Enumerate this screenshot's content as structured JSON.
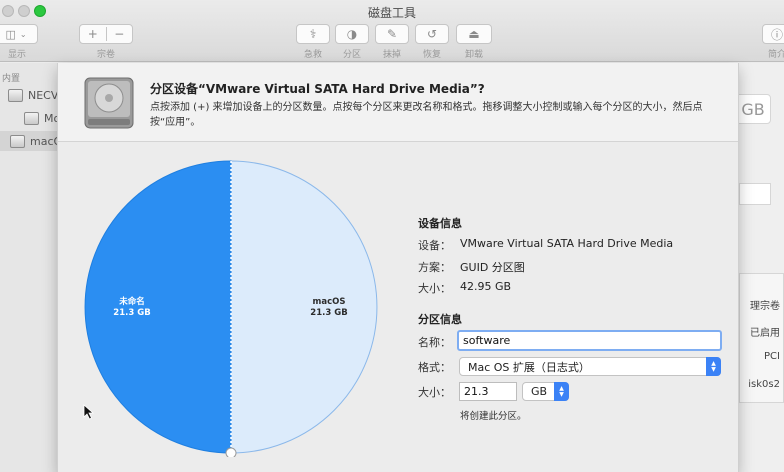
{
  "window": {
    "title": "磁盘工具",
    "toolbar": {
      "view_label": "显示",
      "volume_label": "宗卷",
      "first_aid_label": "急救",
      "partition_label": "分区",
      "erase_label": "抹掉",
      "restore_label": "恢复",
      "unmount_label": "卸载",
      "info_label": "简介"
    }
  },
  "sidebar": {
    "header": "内置",
    "items": [
      {
        "label": "NECV"
      },
      {
        "label": "Mo"
      },
      {
        "label": "macO"
      }
    ]
  },
  "background_right": {
    "capacity_unit": "GB",
    "row1": "理宗卷",
    "row2": "已启用",
    "row3": "PCI",
    "row4": "isk0s2"
  },
  "sheet": {
    "title": "分区设备“VMware Virtual SATA Hard Drive Media”?",
    "description": "点按添加 (+) 来增加设备上的分区数量。点按每个分区来更改名称和格式。拖移调整大小控制或输入每个分区的大小，然后点按“应用”。",
    "device_info": {
      "heading": "设备信息",
      "device_key": "设备：",
      "device_val": "VMware Virtual SATA Hard Drive Media",
      "scheme_key": "方案：",
      "scheme_val": "GUID 分区图",
      "size_key": "大小：",
      "size_val": "42.95 GB"
    },
    "partition_info": {
      "heading": "分区信息",
      "name_key": "名称：",
      "name_value": "software",
      "format_key": "格式：",
      "format_value": "Mac OS 扩展（日志式）",
      "size_key": "大小：",
      "size_value": "21.3",
      "size_unit": "GB",
      "note": "将创建此分区。"
    }
  },
  "chart_data": {
    "type": "pie",
    "title": "",
    "slices": [
      {
        "name": "未命名",
        "size_label": "21.3 GB",
        "value": 21.3,
        "color": "#2b8ef2",
        "selected": true
      },
      {
        "name": "macOS",
        "size_label": "21.3 GB",
        "value": 21.3,
        "color": "#dcebfb",
        "selected": false
      }
    ]
  },
  "colors": {
    "accent": "#3b82f6",
    "selected_slice": "#2b8ef2",
    "unselected_slice": "#dcebfb",
    "focus_ring": "#7eadf2"
  }
}
